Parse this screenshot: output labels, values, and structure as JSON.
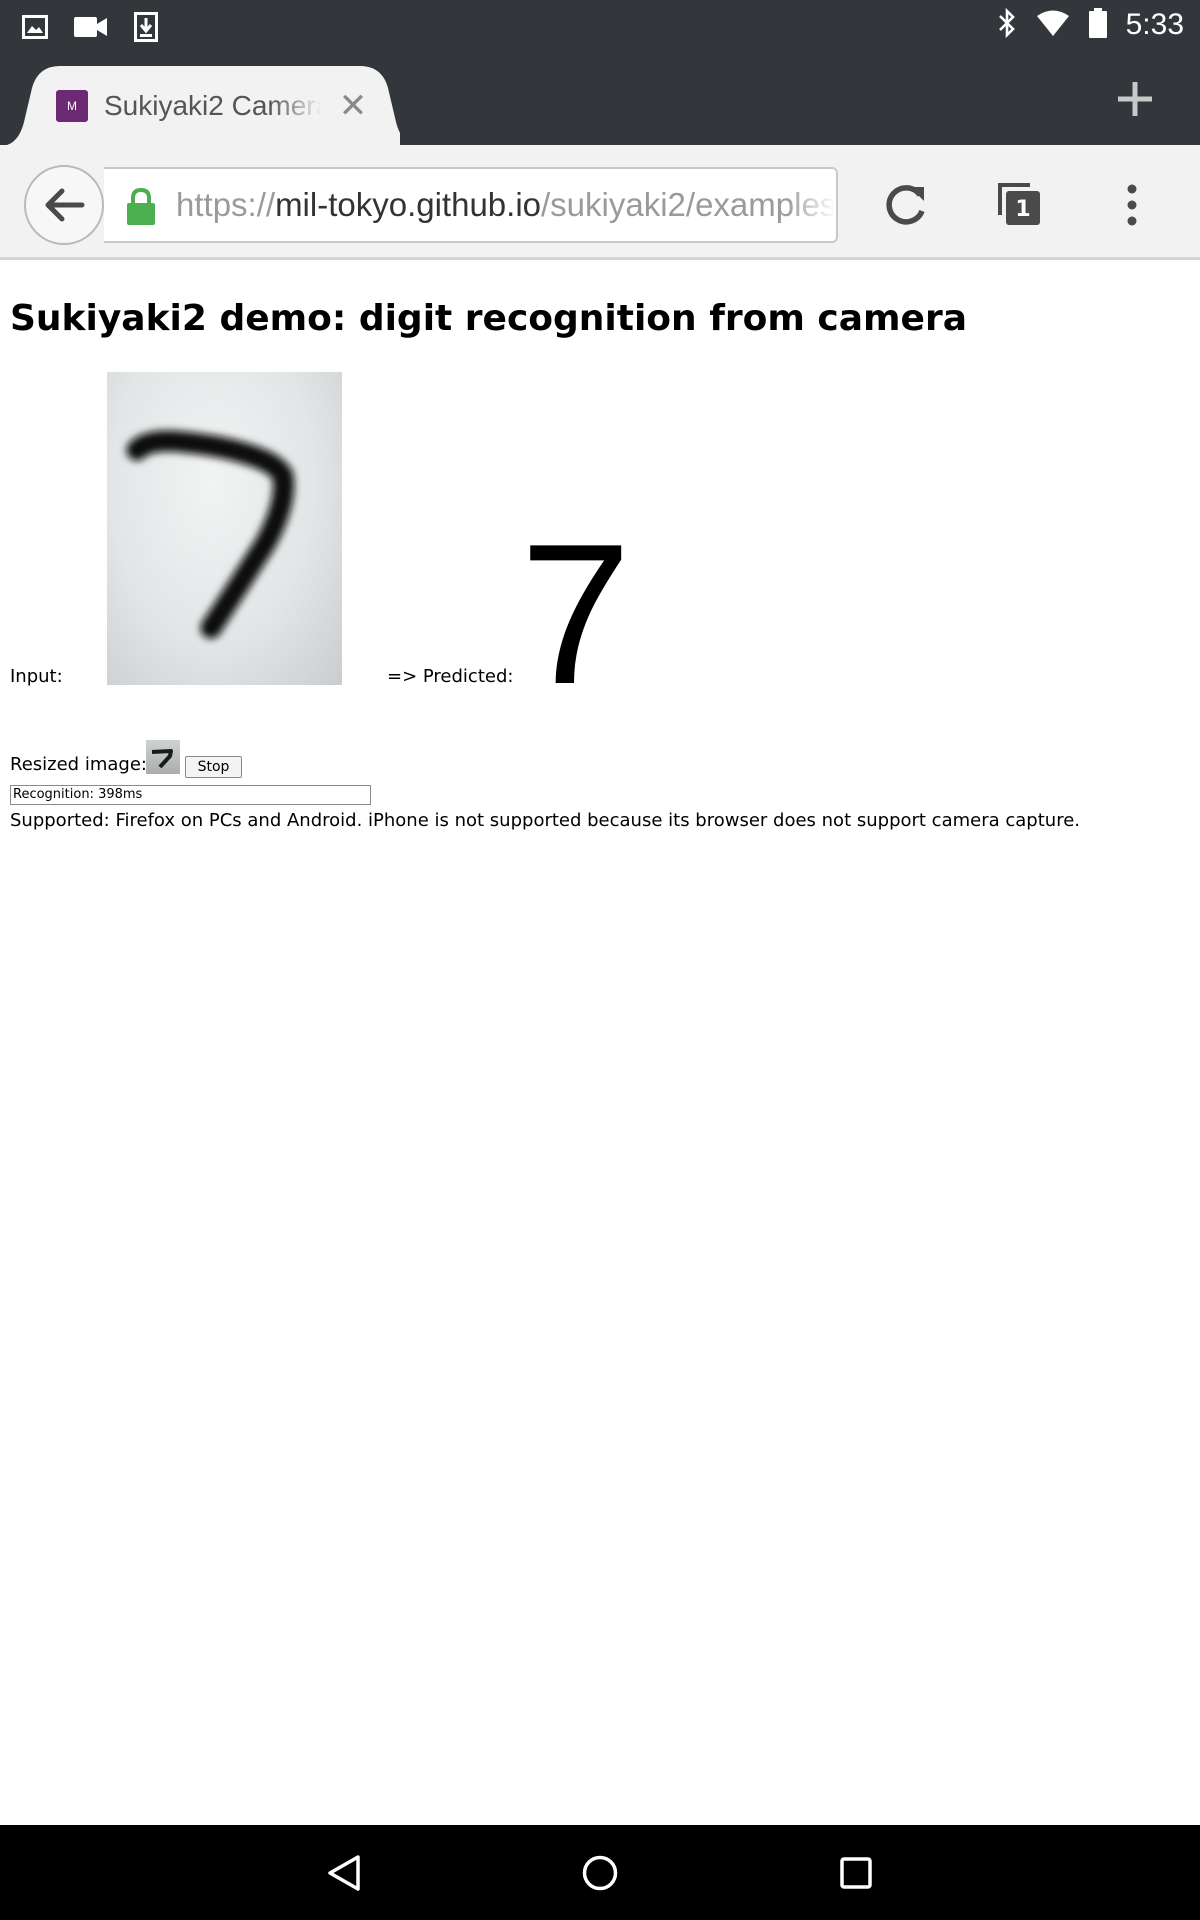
{
  "status_bar": {
    "time": "5:33",
    "left_icons": [
      "image-icon",
      "videocam-icon",
      "download-icon"
    ],
    "right_icons": [
      "bluetooth-icon",
      "wifi-icon",
      "battery-icon"
    ]
  },
  "tab": {
    "favicon_text": "M",
    "favicon_color": "#6c2a74",
    "title": "Sukiyaki2 Camera"
  },
  "toolbar": {
    "url_scheme": "https://",
    "url_host": "mil-tokyo.github.io",
    "url_path": "/sukiyaki2/examples",
    "tab_count": "1",
    "lock_color": "#4caf50"
  },
  "page": {
    "heading": "Sukiyaki2 demo: digit recognition from camera",
    "input_label": "Input:",
    "predicted_label": "=> Predicted:",
    "predicted_digit": "7",
    "resized_label": "Resized image:",
    "stop_button": "Stop",
    "recognition_value": "Recognition: 398ms",
    "supported_note": "Supported: Firefox on PCs and Android. iPhone is not supported because its browser does not support camera capture."
  },
  "colors": {
    "chrome_dark": "#33373c",
    "toolbar_bg": "#f2f2f2"
  }
}
